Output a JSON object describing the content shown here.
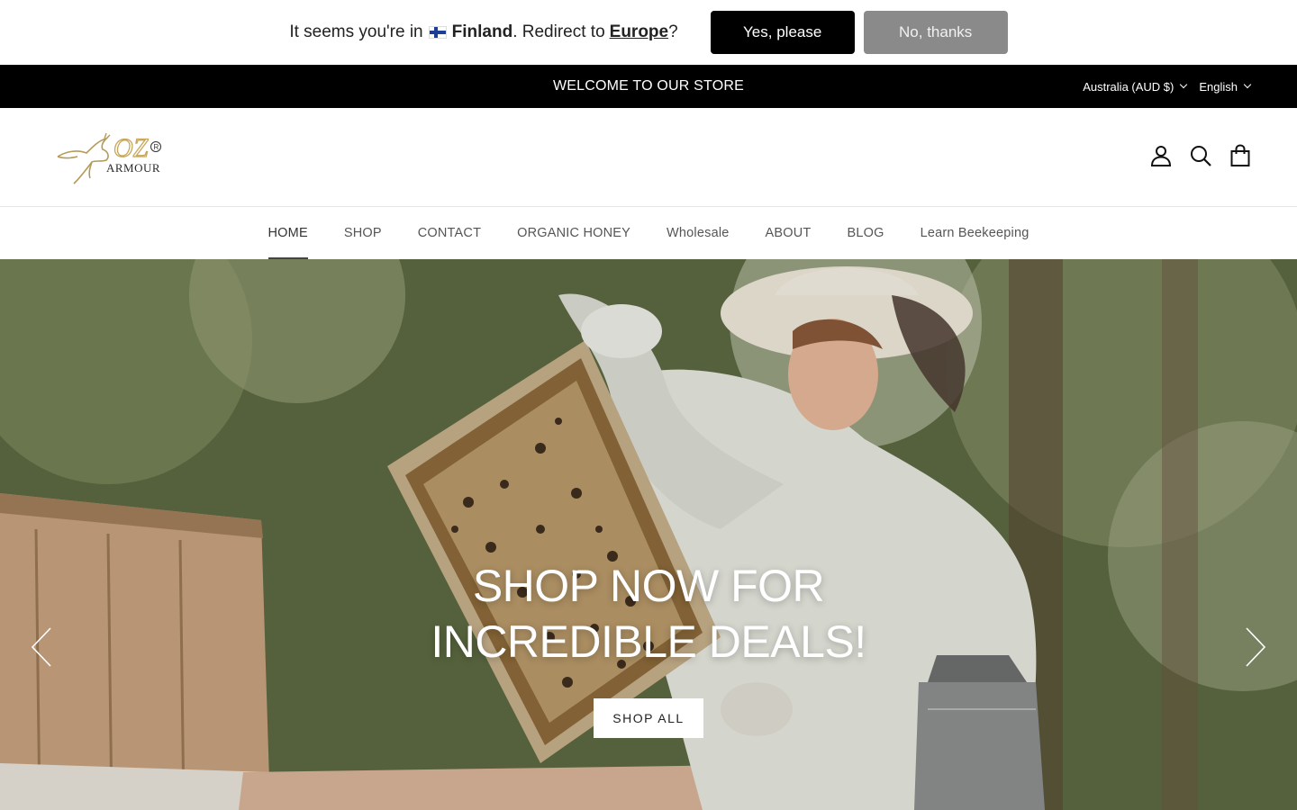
{
  "geo_banner": {
    "prefix": "It seems you're in",
    "country": "Finland",
    "middle": ". Redirect to",
    "region": "Europe",
    "suffix": "?",
    "yes_label": "Yes, please",
    "no_label": "No, thanks"
  },
  "announcement": {
    "text": "WELCOME TO OUR STORE",
    "currency": "Australia (AUD $)",
    "language": "English"
  },
  "header": {
    "logo_text": "ARMOUR",
    "icons": [
      "account-icon",
      "search-icon",
      "cart-icon"
    ]
  },
  "nav": {
    "items": [
      {
        "label": "HOME"
      },
      {
        "label": "SHOP"
      },
      {
        "label": "CONTACT"
      },
      {
        "label": "ORGANIC HONEY"
      },
      {
        "label": "Wholesale"
      },
      {
        "label": "ABOUT"
      },
      {
        "label": "BLOG"
      },
      {
        "label": "Learn Beekeeping"
      }
    ],
    "active": "HOME"
  },
  "hero": {
    "title_line1": "SHOP NOW FOR",
    "title_line2": "INCREDIBLE DEALS!",
    "button_label": "SHOP ALL"
  },
  "colors": {
    "announcement_bg": "#000000",
    "yes_button": "#000000",
    "no_button": "#8a8a8a"
  }
}
